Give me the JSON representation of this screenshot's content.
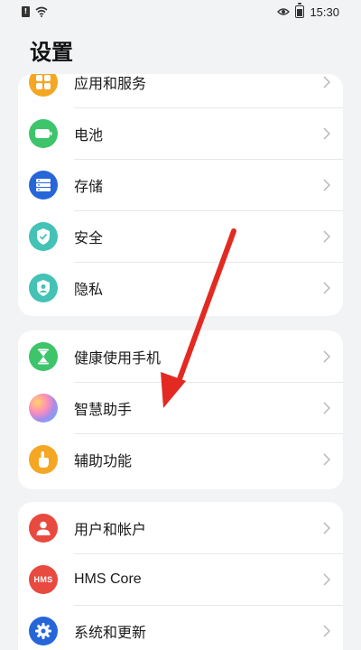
{
  "status_bar": {
    "time": "15:30"
  },
  "page_title": "设置",
  "groups": [
    {
      "items": [
        {
          "label": "应用和服务",
          "icon": "apps-grid-icon",
          "color": "#f5a623"
        },
        {
          "label": "电池",
          "icon": "battery-icon",
          "color": "#3ec46a"
        },
        {
          "label": "存储",
          "icon": "storage-icon",
          "color": "#2766d8"
        },
        {
          "label": "安全",
          "icon": "shield-icon",
          "color": "#43c2b5"
        },
        {
          "label": "隐私",
          "icon": "privacy-icon",
          "color": "#43c2b5"
        }
      ]
    },
    {
      "items": [
        {
          "label": "健康使用手机",
          "icon": "hourglass-icon",
          "color": "#3ec46a"
        },
        {
          "label": "智慧助手",
          "icon": "assistant-orb-icon",
          "color": "#a98ce8"
        },
        {
          "label": "辅助功能",
          "icon": "hand-pointer-icon",
          "color": "#f5a623"
        }
      ]
    },
    {
      "items": [
        {
          "label": "用户和帐户",
          "icon": "user-icon",
          "color": "#e84a3f"
        },
        {
          "label": "HMS Core",
          "icon": "hms-icon",
          "color": "#e84a3f",
          "icon_text": "HMS"
        },
        {
          "label": "系统和更新",
          "icon": "gear-icon",
          "color": "#2766d8"
        }
      ]
    }
  ],
  "annotation_arrow_color": "#e32a22"
}
